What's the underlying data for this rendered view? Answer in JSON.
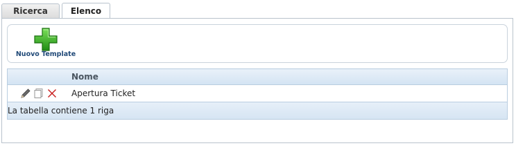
{
  "tabs": [
    {
      "label": "Ricerca",
      "active": false
    },
    {
      "label": "Elenco",
      "active": true
    }
  ],
  "toolbar": {
    "new_template_label": "Nuovo Template",
    "new_template_icon": "plus-icon"
  },
  "grid": {
    "columns": [
      "",
      "Nome"
    ],
    "rows": [
      {
        "actions": [
          "edit-icon",
          "copy-icon",
          "delete-icon"
        ],
        "nome": "Apertura Ticket"
      }
    ],
    "footer": "La tabella contiene 1 riga"
  },
  "colors": {
    "accent_label": "#214a78",
    "plus_green": "#3fae2a",
    "delete_red": "#c81e1e",
    "grid_header_bg": "#dbe8f5"
  }
}
